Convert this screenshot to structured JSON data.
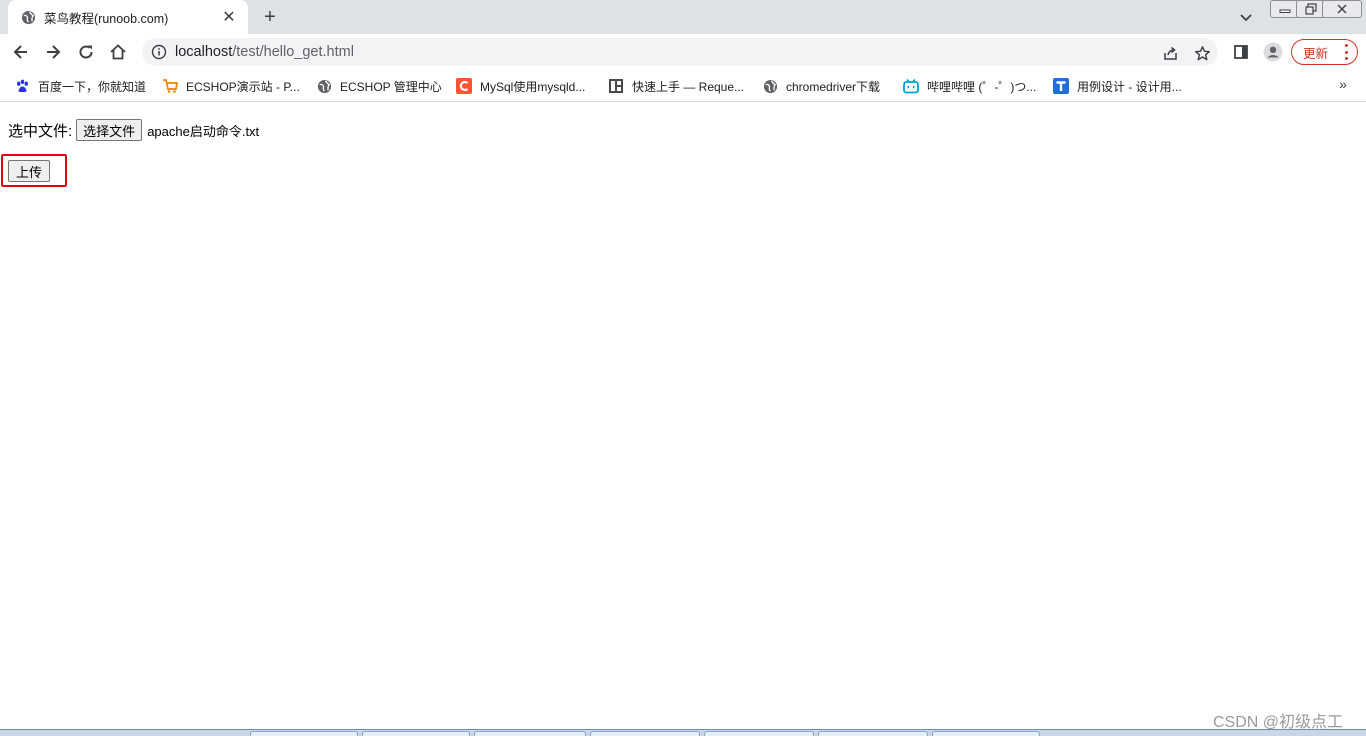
{
  "browser": {
    "tab": {
      "title": "菜鸟教程(runoob.com)",
      "close_glyph": "✕"
    },
    "new_tab_glyph": "+",
    "address": {
      "host": "localhost",
      "path": "/test/hello_get.html"
    },
    "update_button": {
      "label": "更新"
    }
  },
  "bookmarks": [
    {
      "label": "百度一下，你就知道",
      "icon": "baidu-paw-icon",
      "color": "#2932e1"
    },
    {
      "label": "ECSHOP演示站 - P...",
      "icon": "cart-icon",
      "color": "#f08300"
    },
    {
      "label": "ECSHOP 管理中心",
      "icon": "globe-icon",
      "color": "#5f6368"
    },
    {
      "label": "MySql使用mysqld...",
      "icon": "csdn-c-icon",
      "color": "#fc5531"
    },
    {
      "label": "快速上手 — Reque...",
      "icon": "book-icon",
      "color": "#4a4a4a"
    },
    {
      "label": "chromedriver下载",
      "icon": "globe-icon",
      "color": "#5f6368"
    },
    {
      "label": "哔哩哔哩 (゜-゜)つ...",
      "icon": "bilibili-tv-icon",
      "color": "#00a1d6"
    },
    {
      "label": "用例设计 - 设计用...",
      "icon": "t-logo-icon",
      "color": "#1e6fd9"
    }
  ],
  "bookmarks_overflow_glyph": "»",
  "page": {
    "file_label": "选中文件:",
    "choose_button": "选择文件",
    "file_name": "apache启动命令.txt",
    "upload_button": "上传",
    "highlight_color": "#e60012"
  },
  "watermark": "CSDN @初级点工"
}
